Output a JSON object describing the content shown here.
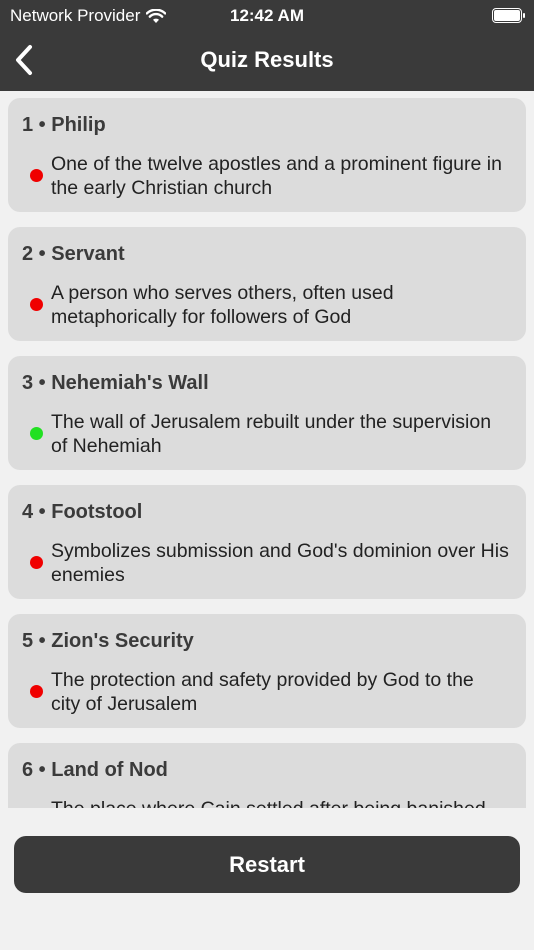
{
  "status_bar": {
    "carrier": "Network Provider",
    "time": "12:42 AM"
  },
  "nav": {
    "title": "Quiz Results",
    "back_icon": "chevron-left-icon"
  },
  "colors": {
    "correct": "#22e022",
    "incorrect": "#f00000",
    "bar": "#3a3a3a",
    "card": "#dcdcdc",
    "background": "#f1f1f1"
  },
  "results": [
    {
      "title": "1 • Philip",
      "line1": "One of the twelve apostles and a prominent figure in",
      "line2": "the early Christian church",
      "correct": false
    },
    {
      "title": "2 • Servant",
      "line1": "A person who serves others, often used",
      "line2": "metaphorically for followers of God",
      "correct": false
    },
    {
      "title": "3 • Nehemiah's Wall",
      "line1": "The wall of Jerusalem rebuilt under the supervision",
      "line2": "of Nehemiah",
      "correct": true
    },
    {
      "title": "4 • Footstool",
      "line1": "Symbolizes submission and God's dominion over His",
      "line2": "enemies",
      "correct": false
    },
    {
      "title": "5 • Zion's Security",
      "line1": "The protection and safety provided by God to the",
      "line2": "city of Jerusalem",
      "correct": false
    },
    {
      "title": "6 • Land of Nod",
      "line1": "The place where Cain settled after being banished",
      "line2": "",
      "correct": false
    }
  ],
  "restart_label": "Restart"
}
